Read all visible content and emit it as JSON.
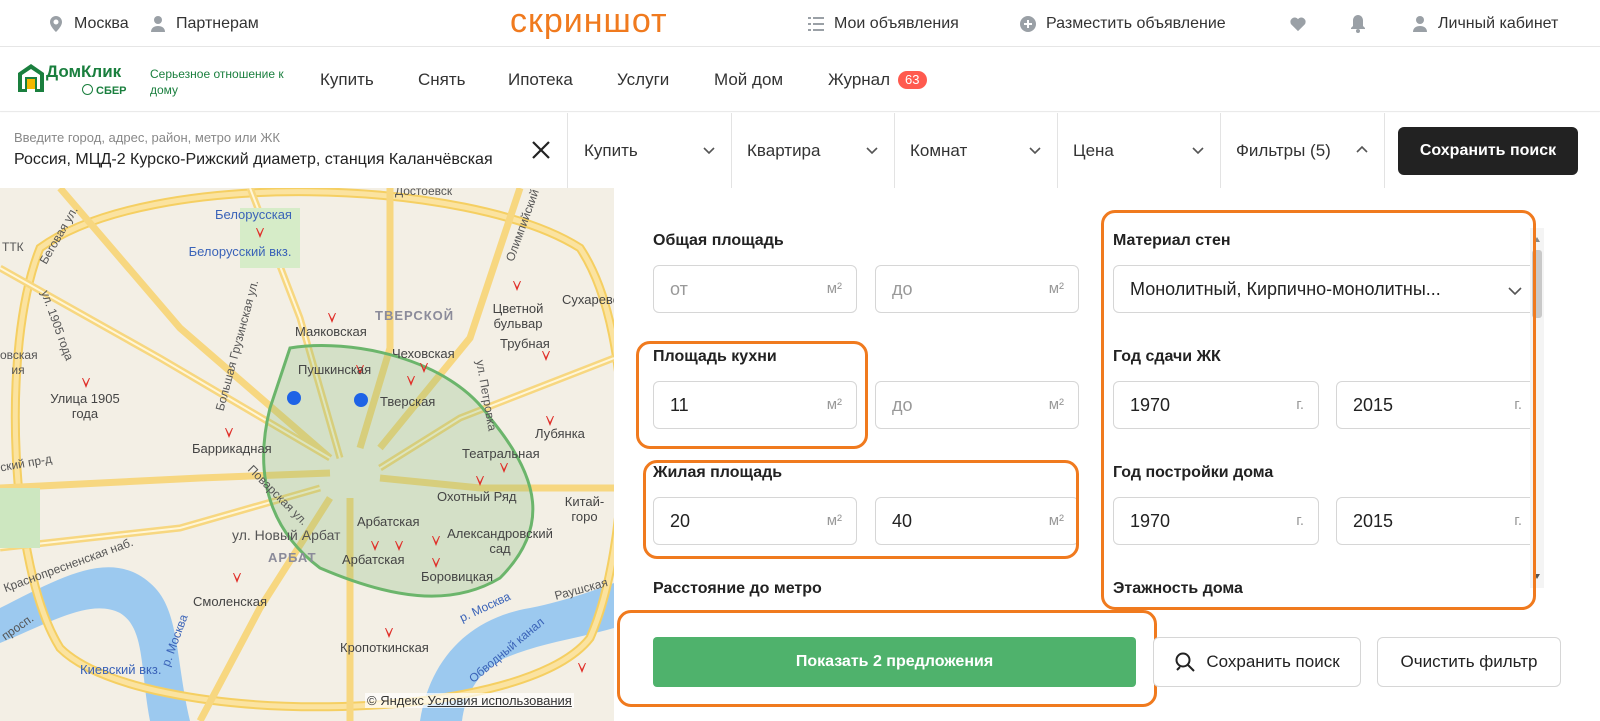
{
  "watermark": "скриншот",
  "topbar": {
    "city": "Москва",
    "partners": "Партнерам",
    "my_ads": "Мои объявления",
    "post_ad": "Разместить объявление",
    "cabinet": "Личный кабинет"
  },
  "brand": {
    "name": "ДомКлик",
    "sub": "СБЕР",
    "slogan": "Серьезное отношение к дому",
    "color": "#1a7f3e"
  },
  "nav": {
    "items": [
      {
        "label": "Купить"
      },
      {
        "label": "Снять"
      },
      {
        "label": "Ипотека"
      },
      {
        "label": "Услуги"
      },
      {
        "label": "Мой дом"
      },
      {
        "label": "Журнал",
        "badge": "63"
      }
    ]
  },
  "search": {
    "placeholder": "Введите город, адрес, район, метро или ЖК",
    "value": "Россия, МЦД-2 Курско-Рижский диаметр, станция Каланчёвская",
    "deal": "Купить",
    "type": "Квартира",
    "rooms": "Комнат",
    "price": "Цена",
    "filters": "Фильтры (5)",
    "save": "Сохранить поиск"
  },
  "map": {
    "labels": {
      "belorusskaya": "Белорусская",
      "belorussky_vokzal": "Белорусский вкз.",
      "mayakovskaya": "Маяковская",
      "tverskoy": "ТВЕРСКОЙ",
      "tsvetnoy": "Цветной бульвар",
      "sukharevskaya": "Сухаревс",
      "trubnaya": "Трубная",
      "chekhovskaya": "Чеховская",
      "pushkinskaya": "Пушкинская",
      "tverskaya": "Тверская",
      "lubyanka": "Лубянка",
      "teatralnaya": "Театральная",
      "okhotny": "Охотный Ряд",
      "kitay": "Китай-горо",
      "barrikadnaya": "Баррикадная",
      "ulitsa1905": "Улица 1905 года",
      "arbatskaya1": "Арбатская",
      "arbatskaya2": "Арбатская",
      "aleksandrovsky": "Александровский сад",
      "borovitskaya": "Боровицкая",
      "arbat": "АРБАТ",
      "novy_arbat": "ул. Новый Арбат",
      "smolenskaya": "Смоленская",
      "kropotkinskaya": "Кропоткинская",
      "kievsky": "Киевский вкз.",
      "beg": "Беговая ул.",
      "ttk": "ТТК",
      "ul1905": "ул. 1905 года",
      "krasnopresn": "Краснопресненская наб.",
      "presn": "овская ия",
      "zvenig": "ский пр-д",
      "bgruzin": "Большая Грузинская ул.",
      "povarskaya": "Поварская ул.",
      "petrovka": "ул. Петровка",
      "olimpiysky": "Олимпийский",
      "moskva_river": "р. Москва",
      "obvodny": "Обводный канал",
      "raush": "Раушская",
      "prosp": "просп.",
      "moskva2": "р. Москва",
      "dostoev": "Достоевск"
    },
    "copyright_prefix": "© Яндекс",
    "terms": "Условия использования"
  },
  "filters": {
    "total_area": {
      "label": "Общая площадь",
      "from_ph": "от",
      "to_ph": "до",
      "unit": "м²"
    },
    "kitchen_area": {
      "label": "Площадь кухни",
      "from": "11",
      "to_ph": "до",
      "unit": "м²"
    },
    "living_area": {
      "label": "Жилая площадь",
      "from": "20",
      "to": "40",
      "unit": "м²"
    },
    "metro_distance": {
      "label": "Расстояние до метро"
    },
    "wall_material": {
      "label": "Материал стен",
      "value": "Монолитный, Кирпично-монолитны..."
    },
    "completion_year": {
      "label": "Год сдачи ЖК",
      "from": "1970",
      "to": "2015",
      "unit": "г."
    },
    "build_year": {
      "label": "Год постройки дома",
      "from": "1970",
      "to": "2015",
      "unit": "г."
    },
    "floors": {
      "label": "Этажность дома"
    }
  },
  "actions": {
    "show": "Показать 2 предложения",
    "save": "Сохранить поиск",
    "clear": "Очистить фильтр"
  },
  "colors": {
    "accent_green": "#4fb26c",
    "highlight_orange": "#f07a1e",
    "badge_red": "#ff5a4e"
  }
}
